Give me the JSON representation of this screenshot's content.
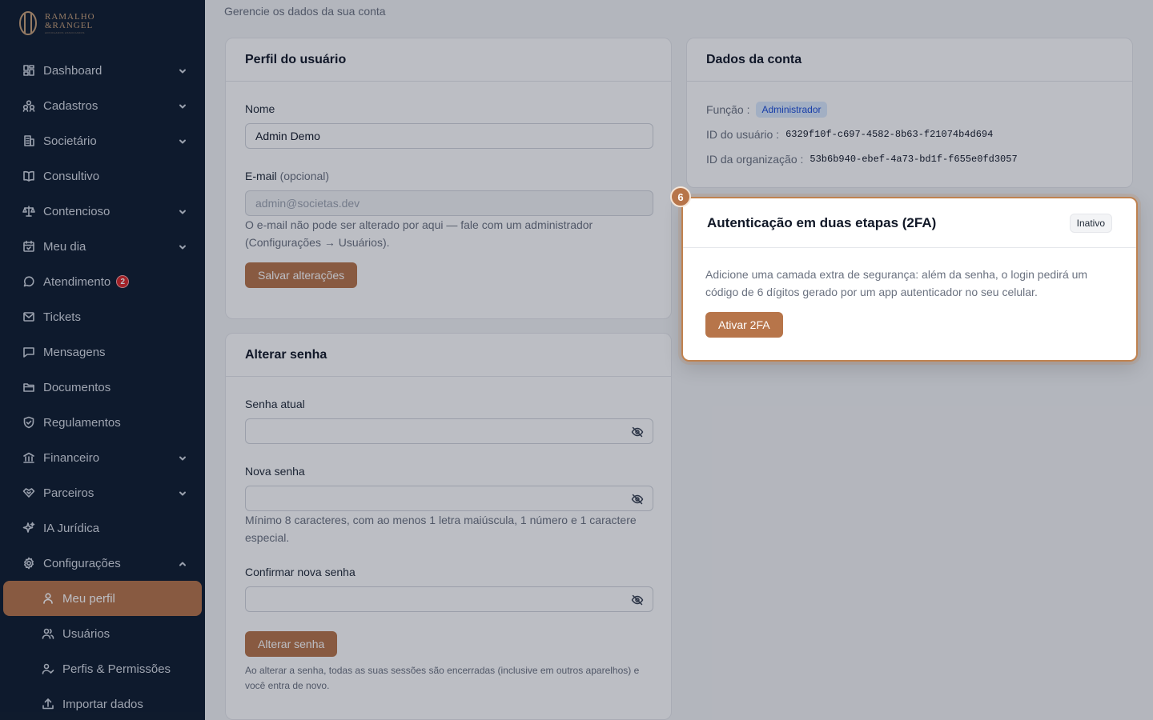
{
  "brand": {
    "line1": "RAMALHO",
    "line2": "&RANGEL",
    "tagline": "ADVOGADOS ASSOCIADOS",
    "accent": "#b7754a"
  },
  "sidebar": {
    "items": [
      {
        "label": "Dashboard",
        "icon": "dashboard-icon",
        "has_chevron": true
      },
      {
        "label": "Cadastros",
        "icon": "users-group-icon",
        "has_chevron": true
      },
      {
        "label": "Societário",
        "icon": "building-icon",
        "has_chevron": true
      },
      {
        "label": "Consultivo",
        "icon": "book-icon",
        "has_chevron": false
      },
      {
        "label": "Contencioso",
        "icon": "scale-icon",
        "has_chevron": true
      },
      {
        "label": "Meu dia",
        "icon": "calendar-icon",
        "has_chevron": true
      },
      {
        "label": "Atendimento",
        "icon": "chat-icon",
        "badge": "2"
      },
      {
        "label": "Tickets",
        "icon": "ticket-icon"
      },
      {
        "label": "Mensagens",
        "icon": "message-icon"
      },
      {
        "label": "Documentos",
        "icon": "folder-icon"
      },
      {
        "label": "Regulamentos",
        "icon": "shield-icon"
      },
      {
        "label": "Financeiro",
        "icon": "bank-icon",
        "has_chevron": true
      },
      {
        "label": "Parceiros",
        "icon": "handshake-icon",
        "has_chevron": true
      },
      {
        "label": "IA Jurídica",
        "icon": "sparkles-icon"
      },
      {
        "label": "Configurações",
        "icon": "gear-icon",
        "expanded": true
      }
    ],
    "subitems": [
      {
        "label": "Meu perfil",
        "icon": "user-icon",
        "active": true
      },
      {
        "label": "Usuários",
        "icon": "users-icon"
      },
      {
        "label": "Perfis & Permissões",
        "icon": "user-check-icon"
      },
      {
        "label": "Importar dados",
        "icon": "upload-icon"
      }
    ]
  },
  "header": {
    "subtitle": "Gerencie os dados da sua conta"
  },
  "profile": {
    "title": "Perfil do usuário",
    "name_label": "Nome",
    "name_value": "Admin Demo",
    "email_label": "E-mail",
    "email_optional": "(opcional)",
    "email_value": "admin@societas.dev",
    "email_help": "O e-mail não pode ser alterado por aqui — fale com um administrador (Configurações → Usuários).",
    "save_button": "Salvar alterações"
  },
  "password": {
    "title": "Alterar senha",
    "current_label": "Senha atual",
    "new_label": "Nova senha",
    "new_help": "Mínimo 8 caracteres, com ao menos 1 letra maiúscula, 1 número e 1 caractere especial.",
    "confirm_label": "Confirmar nova senha",
    "submit_button": "Alterar senha",
    "note": "Ao alterar a senha, todas as suas sessões são encerradas (inclusive em outros aparelhos) e você entra de novo."
  },
  "account": {
    "title": "Dados da conta",
    "role_label": "Função :",
    "role_value": "Administrador",
    "user_id_label": "ID do usuário :",
    "user_id_value": "6329f10f-c697-4582-8b63-f21074b4d694",
    "org_id_label": "ID da organização :",
    "org_id_value": "53b6b940-ebef-4a73-bd1f-f655e0fd3057"
  },
  "twofa": {
    "step": "6",
    "title": "Autenticação em duas etapas (2FA)",
    "status": "Inativo",
    "description": "Adicione uma camada extra de segurança: além da senha, o login pedirá um código de 6 dígitos gerado por um app autenticador no seu celular.",
    "button": "Ativar 2FA"
  }
}
